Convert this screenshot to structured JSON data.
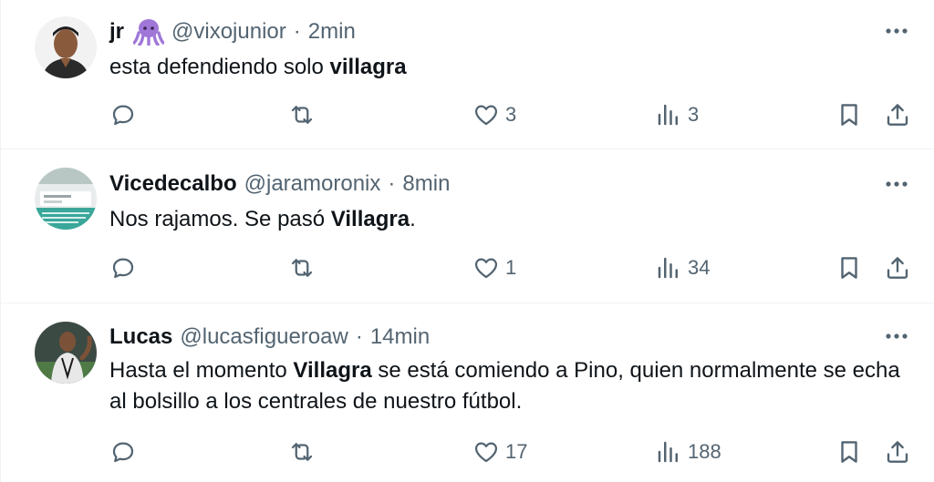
{
  "colors": {
    "text_primary": "#0f1419",
    "text_secondary": "#536471",
    "divider": "#eff3f4",
    "emoji_octopus": "#a077d8"
  },
  "tweets": [
    {
      "name": "jr",
      "name_emoji": "octopus-emoji",
      "handle": "@vixojunior",
      "separator": "·",
      "time": "2min",
      "text_before": "esta defendiendo solo ",
      "text_bold": "villagra",
      "text_after": "",
      "reply_count": "",
      "retweet_count": "",
      "like_count": "3",
      "view_count": "3",
      "avatar_icon": "person-avatar"
    },
    {
      "name": "Vicedecalbo",
      "handle": "@jaramoronix",
      "separator": "·",
      "time": "8min",
      "text_before": "Nos rajamos. Se pasó ",
      "text_bold": "Villagra",
      "text_after": ".",
      "reply_count": "",
      "retweet_count": "",
      "like_count": "1",
      "view_count": "34",
      "avatar_icon": "screenshot-avatar"
    },
    {
      "name": "Lucas",
      "handle": "@lucasfigueroaw",
      "separator": "·",
      "time": "14min",
      "text_before": "Hasta el momento ",
      "text_bold": "Villagra",
      "text_after": " se está comiendo a Pino, quien normalmente se echa al bolsillo a los centrales de nuestro fútbol.",
      "reply_count": "",
      "retweet_count": "",
      "like_count": "17",
      "view_count": "188",
      "avatar_icon": "player-avatar"
    }
  ],
  "icons": {
    "more": "more-horizontal-icon",
    "reply": "reply-icon",
    "retweet": "retweet-icon",
    "like": "heart-icon",
    "views": "views-bar-chart-icon",
    "bookmark": "bookmark-icon",
    "share": "share-icon"
  }
}
